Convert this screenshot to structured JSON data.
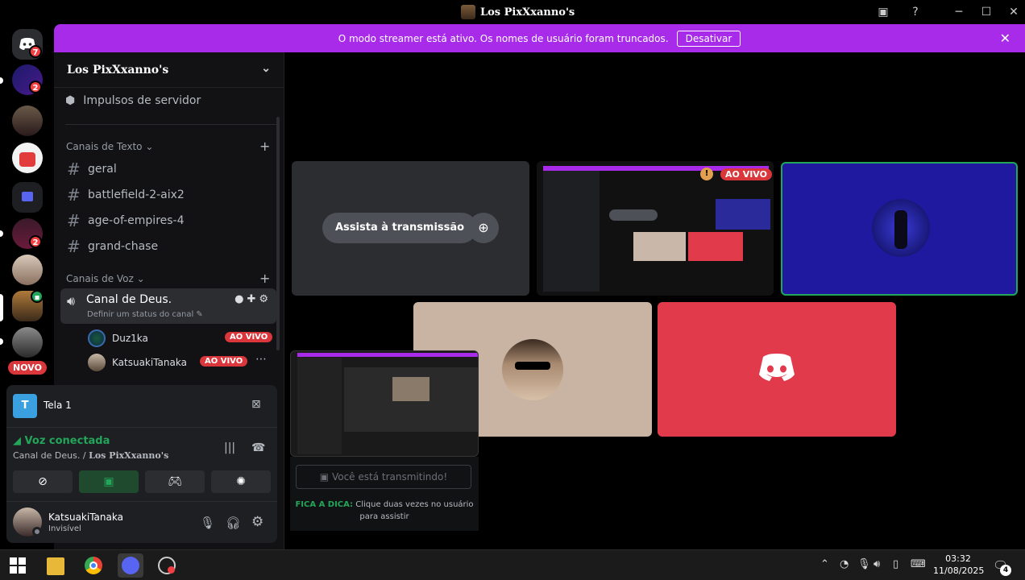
{
  "window": {
    "title": "Los PixXxanno's"
  },
  "rail": {
    "dm_badge": "7",
    "badge_2a": "2",
    "badge_2b": "2",
    "new_label": "NOVO"
  },
  "banner": {
    "text": "O modo streamer está ativo. Os nomes de usuário foram truncados.",
    "button": "Desativar"
  },
  "sidebar": {
    "server_name": "Los PixXxanno's",
    "boosts": "Impulsos de servidor",
    "text_category": "Canais de Texto",
    "text_channels": [
      "geral",
      "battlefield-2-aix2",
      "age-of-empires-4",
      "grand-chase"
    ],
    "voice_category": "Canais de Voz",
    "voice_channel": {
      "name": "Canal de Deus.",
      "status": "Definir um status do canal"
    },
    "voice_users": [
      {
        "name": "Duz1ka",
        "live": "AO VIVO"
      },
      {
        "name": "KatsuakiTanaka",
        "live": "AO VIVO"
      }
    ]
  },
  "panel": {
    "screen_label": "Tela 1",
    "voice_status": "Voz conectada",
    "voice_channel": "Canal de Deus. / ",
    "voice_server": "Los PixXxanno's",
    "user_name": "KatsuakiTanaka",
    "user_status": "Invisível"
  },
  "stage": {
    "watch_button": "Assista à transmissão",
    "live_badge": "AO VIVO",
    "you_streaming": "Você está transmitindo!",
    "tip_label": "FICA A DICA:",
    "tip_text": "Clique duas vezes no usuário",
    "tip_text2": "para assistir"
  },
  "taskbar": {
    "time": "03:32",
    "date": "11/08/2025",
    "notifications": "4"
  },
  "colors": {
    "banner": "#a72be8",
    "live": "#da373c",
    "connected": "#23a55a",
    "discord_red": "#e13a4a",
    "discord_blurple": "#5865f2"
  }
}
